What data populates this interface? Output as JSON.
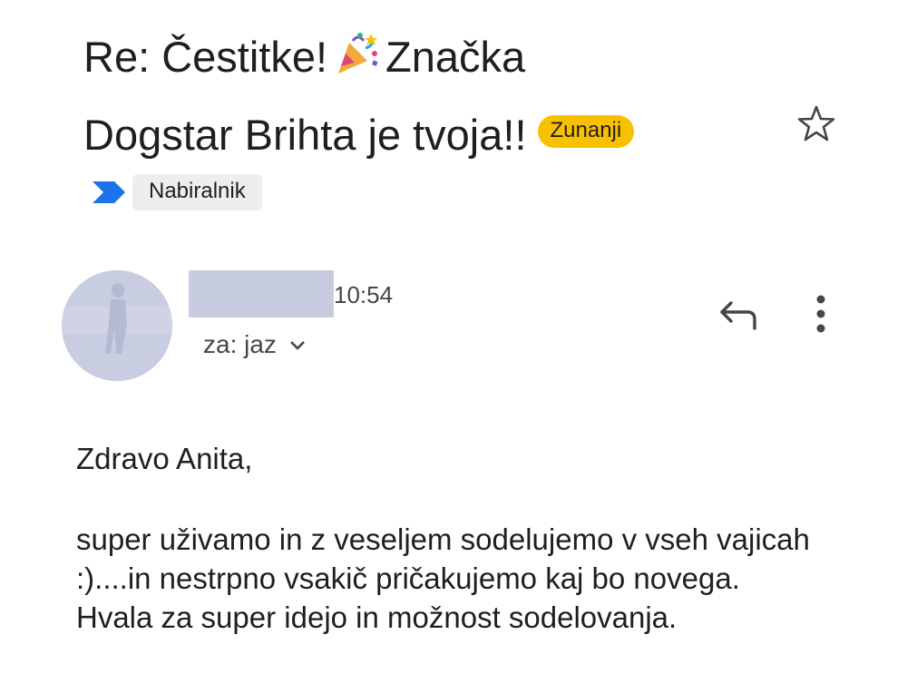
{
  "email": {
    "subject_line1_part1": "Re: Čestitke!",
    "subject_line1_part2": "Značka",
    "subject_line2": "Dogstar Brihta je tvoja!!",
    "external_badge": "Zunanji",
    "label": "Nabiralnik",
    "time": "10:54",
    "recipient": "za: jaz",
    "body": {
      "greeting": "Zdravo Anita,",
      "paragraph1": "super uživamo in z veseljem sodelujemo v vseh vajicah :)....in nestrpno vsakič pričakujemo kaj bo novega.",
      "paragraph2": "Hvala za super idejo in možnost sodelovanja."
    }
  },
  "icons": {
    "subject_emoji": "party-popper-icon",
    "star": "star-outline-icon",
    "label_marker": "importance-marker-icon",
    "reply": "reply-icon",
    "more": "more-vert-icon",
    "recipient_expand": "chevron-down-icon"
  },
  "colors": {
    "badge_bg": "#f8c100",
    "label_marker": "#1a73e8",
    "chip_bg": "#eeeeee",
    "redaction": "#c8cce0"
  }
}
